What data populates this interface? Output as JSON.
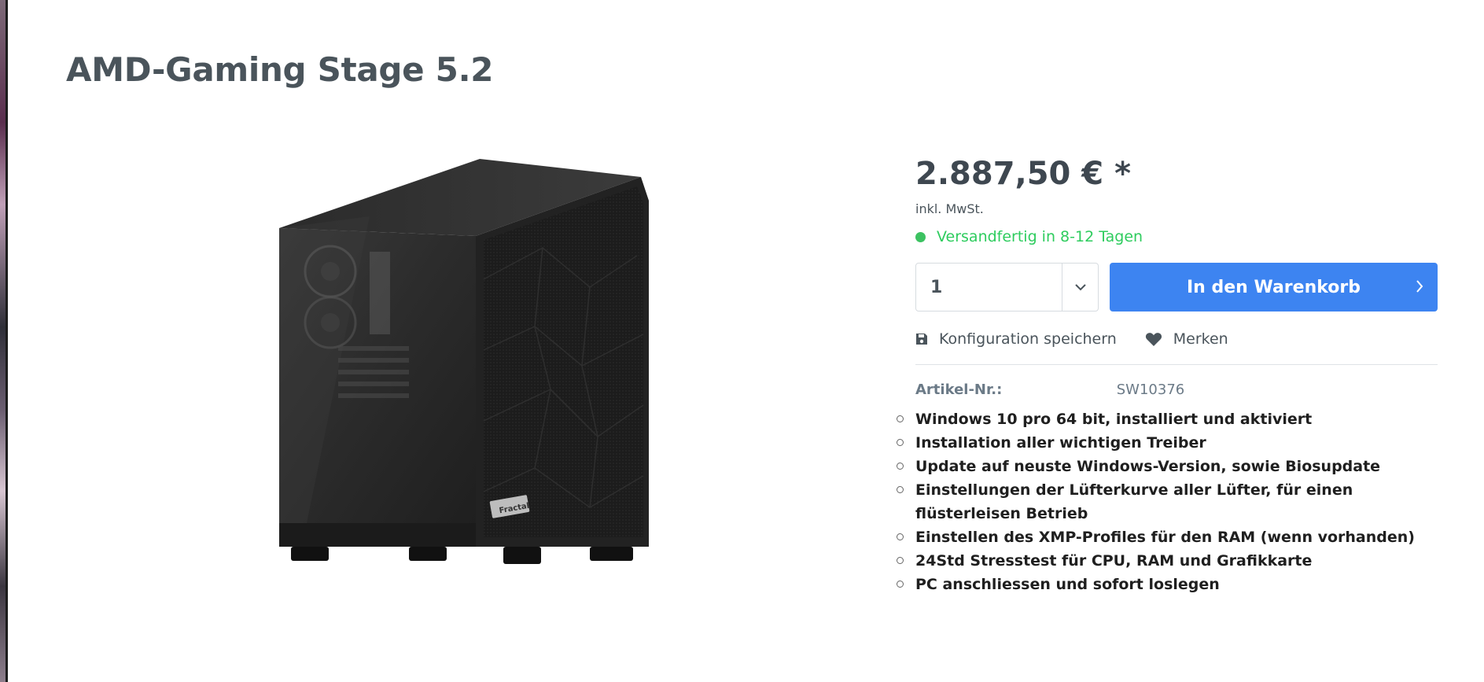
{
  "product": {
    "title": "AMD-Gaming Stage 5.2",
    "image_alt": "PC-Gehäuse Fractal",
    "case_brand": "Fractal"
  },
  "buy_box": {
    "price": "2.887,50 € *",
    "tax_note": "inkl. MwSt.",
    "delivery_status": "Versandfertig in 8-12 Tagen",
    "quantity": "1",
    "add_to_cart_label": "In den Warenkorb",
    "save_config_label": "Konfiguration speichern",
    "wishlist_label": "Merken",
    "sku_label": "Artikel-Nr.:",
    "sku_value": "SW10376"
  },
  "features": [
    "Windows 10 pro 64 bit, installiert und aktiviert",
    "Installation aller wichtigen Treiber",
    "Update auf neuste Windows-Version, sowie Biosupdate",
    "Einstellungen der Lüfterkurve aller Lüfter, für einen flüsterleisen Betrieb",
    "Einstellen des XMP-Profiles für den RAM (wenn vorhanden)",
    "24Std Stresstest für CPU, RAM und Grafikkarte",
    "PC anschliessen und sofort loslegen"
  ],
  "colors": {
    "accent": "#3d84f1",
    "delivery_green": "#2ecc5e",
    "title": "#4a545b"
  },
  "icons": {
    "qty_arrow": "chevron-down-icon",
    "cart": "chevron-right-icon",
    "save": "floppy-disk-icon",
    "wishlist": "heart-icon"
  }
}
